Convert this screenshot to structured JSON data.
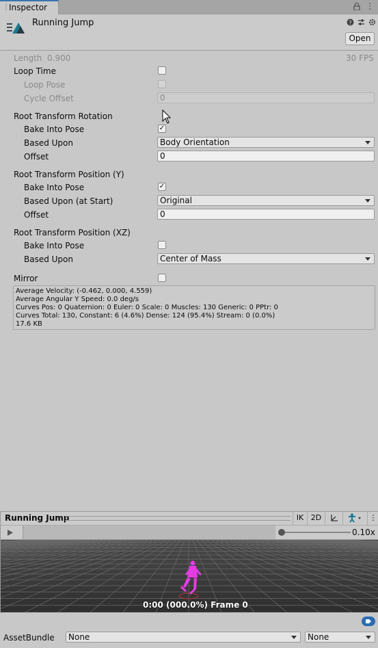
{
  "tab": {
    "title": "Inspector"
  },
  "header": {
    "title": "Running Jump",
    "open_label": "Open"
  },
  "clip": {
    "length_label": "Length",
    "length_value": "0.900",
    "fps": "30 FPS"
  },
  "loop": {
    "loop_time": "Loop Time",
    "loop_pose": "Loop Pose",
    "cycle_offset": "Cycle Offset",
    "cycle_offset_value": "0"
  },
  "rotation": {
    "title": "Root Transform Rotation",
    "bake_label": "Bake Into Pose",
    "based_label": "Based Upon",
    "based_value": "Body Orientation",
    "offset_label": "Offset",
    "offset_value": "0"
  },
  "position_y": {
    "title": "Root Transform Position (Y)",
    "bake_label": "Bake Into Pose",
    "based_label": "Based Upon (at Start)",
    "based_value": "Original",
    "offset_label": "Offset",
    "offset_value": "0"
  },
  "position_xz": {
    "title": "Root Transform Position (XZ)",
    "bake_label": "Bake Into Pose",
    "based_label": "Based Upon",
    "based_value": "Center of Mass"
  },
  "mirror": {
    "label": "Mirror"
  },
  "info": {
    "line1": "Average Velocity: (-0.462, 0.000, 4.559)",
    "line2": "Average Angular Y Speed: 0.0 deg/s",
    "line3": "Curves Pos: 0 Quaternion: 0 Euler: 0 Scale: 0 Muscles: 130 Generic: 0 PPtr: 0",
    "line4": "Curves Total: 130, Constant: 6 (4.6%) Dense: 124 (95.4%) Stream: 0 (0.0%)",
    "line5": "17.6 KB"
  },
  "preview": {
    "title": "Running Jump",
    "ik_label": "IK",
    "mode_2d_label": "2D",
    "speed": "0.10x",
    "time_readout": "0:00 (000.0%) Frame 0"
  },
  "asset_bundle": {
    "label": "AssetBundle",
    "name_value": "None",
    "variant_value": "None"
  }
}
